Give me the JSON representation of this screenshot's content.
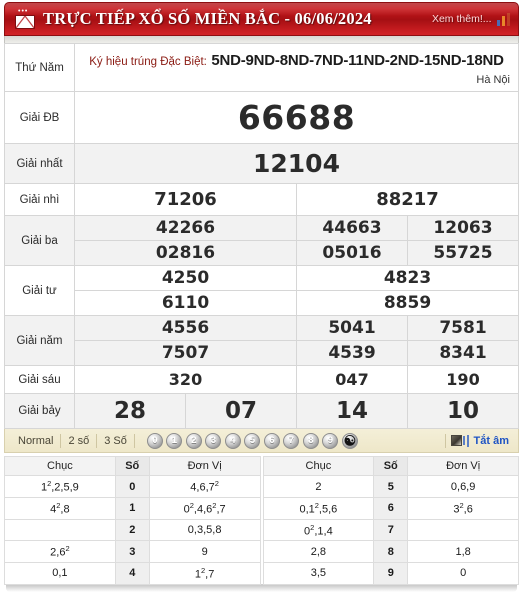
{
  "header": {
    "title": "TRỰC TIẾP XỔ SỐ MIỀN BẮC - 06/06/2024",
    "more_label": "Xem thêm!...",
    "mail_icon": "mail-icon",
    "chart_icon": "bar-chart-icon",
    "dots": "•••"
  },
  "meta": {
    "weekday": "Thứ Năm",
    "code_label": "Ký hiệu trúng Đặc Biệt:",
    "code_value": "5ND-9ND-8ND-7ND-11ND-2ND-15ND-18ND",
    "province": "Hà Nội"
  },
  "prizes": [
    {
      "label": "Giải ĐB",
      "numbers": [
        "66688"
      ]
    },
    {
      "label": "Giải nhất",
      "numbers": [
        "12104"
      ]
    },
    {
      "label": "Giải nhì",
      "numbers": [
        "71206",
        "88217"
      ]
    },
    {
      "label": "Giải ba",
      "numbers": [
        "42266",
        "44663",
        "12063",
        "02816",
        "05016",
        "55725"
      ]
    },
    {
      "label": "Giải tư",
      "numbers": [
        "4250",
        "4823",
        "6110",
        "8859"
      ]
    },
    {
      "label": "Giải năm",
      "numbers": [
        "4556",
        "5041",
        "7581",
        "7507",
        "4539",
        "8341"
      ]
    },
    {
      "label": "Giải sáu",
      "numbers": [
        "320",
        "047",
        "190"
      ]
    },
    {
      "label": "Giải bảy",
      "numbers": [
        "28",
        "07",
        "14",
        "10"
      ]
    }
  ],
  "prize_values": {
    "db": "66688",
    "nhat": "12104",
    "nhi_1": "71206",
    "nhi_2": "88217",
    "ba_1": "42266",
    "ba_2": "44663",
    "ba_3": "12063",
    "ba_4": "02816",
    "ba_5": "05016",
    "ba_6": "55725",
    "tu_1": "4250",
    "tu_2": "4823",
    "tu_3": "6110",
    "tu_4": "8859",
    "nam_1": "4556",
    "nam_2": "5041",
    "nam_3": "7581",
    "nam_4": "7507",
    "nam_5": "4539",
    "nam_6": "8341",
    "sau_1": "320",
    "sau_2": "047",
    "sau_3": "190",
    "bay_1": "28",
    "bay_2": "07",
    "bay_3": "14",
    "bay_4": "10"
  },
  "toolbar": {
    "normal_label": "Normal",
    "two_digit_label": "2 số",
    "three_digit_label": "3 Số",
    "balls": [
      "0",
      "1",
      "2",
      "3",
      "4",
      "5",
      "6",
      "7",
      "8",
      "9"
    ],
    "yin_yang_label": "☯",
    "speaker_icon": "speaker-icon",
    "mute_label": "Tắt âm"
  },
  "stats": {
    "headers": {
      "chuc": "Chục",
      "so": "Số",
      "donvi": "Đơn Vị"
    },
    "left_rows": [
      {
        "chuc": [
          {
            "d": "1",
            "sup": "2"
          },
          {
            "d": "2"
          },
          {
            "d": "5"
          },
          {
            "d": "9"
          }
        ],
        "so": "0",
        "donvi": [
          {
            "d": "4"
          },
          {
            "d": "6"
          },
          {
            "d": "7",
            "sup": "2"
          }
        ]
      },
      {
        "chuc": [
          {
            "d": "4",
            "sup": "2"
          },
          {
            "d": "8"
          }
        ],
        "so": "1",
        "donvi": [
          {
            "d": "0",
            "sup": "2"
          },
          {
            "d": "4"
          },
          {
            "d": "6",
            "sup": "2"
          },
          {
            "d": "7"
          }
        ]
      },
      {
        "chuc": [],
        "so": "2",
        "donvi": [
          {
            "d": "0"
          },
          {
            "d": "3"
          },
          {
            "d": "5"
          },
          {
            "d": "8"
          }
        ]
      },
      {
        "chuc": [
          {
            "d": "2"
          },
          {
            "d": "6",
            "sup": "2"
          }
        ],
        "so": "3",
        "donvi": [
          {
            "d": "9"
          }
        ]
      },
      {
        "chuc": [
          {
            "d": "0"
          },
          {
            "d": "1"
          }
        ],
        "so": "4",
        "donvi": [
          {
            "d": "1",
            "sup": "2"
          },
          {
            "d": "7"
          }
        ]
      }
    ],
    "right_rows": [
      {
        "chuc": [
          {
            "d": "2"
          }
        ],
        "so": "5",
        "donvi": [
          {
            "d": "0"
          },
          {
            "d": "6"
          },
          {
            "d": "9"
          }
        ]
      },
      {
        "chuc": [
          {
            "d": "0"
          },
          {
            "d": "1",
            "sup": "2"
          },
          {
            "d": "5"
          },
          {
            "d": "6"
          }
        ],
        "so": "6",
        "donvi": [
          {
            "d": "3",
            "sup": "2"
          },
          {
            "d": "6"
          }
        ]
      },
      {
        "chuc": [
          {
            "d": "0",
            "sup": "2"
          },
          {
            "d": "1"
          },
          {
            "d": "4"
          }
        ],
        "so": "7",
        "donvi": []
      },
      {
        "chuc": [
          {
            "d": "2"
          },
          {
            "d": "8"
          }
        ],
        "so": "8",
        "donvi": [
          {
            "d": "1"
          },
          {
            "d": "8"
          }
        ]
      },
      {
        "chuc": [
          {
            "d": "3"
          },
          {
            "d": "5"
          }
        ],
        "so": "9",
        "donvi": [
          {
            "d": "0"
          }
        ]
      }
    ]
  },
  "colors": {
    "header_red": "#b01418",
    "prize_red": "#9b1018",
    "text_dark": "#2b2b2b",
    "toolbar_bg": "#f0e9cd",
    "link_blue": "#1f54c4"
  }
}
